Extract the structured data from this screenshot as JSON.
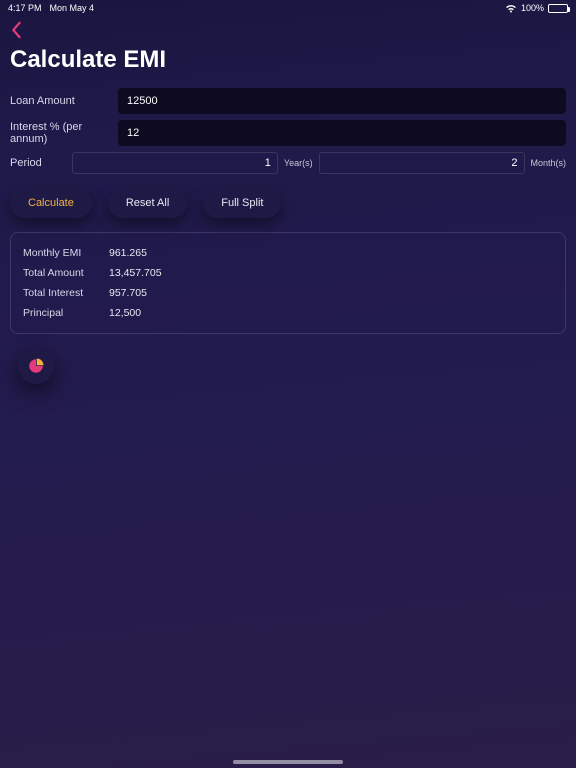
{
  "status": {
    "time": "4:17 PM",
    "date": "Mon May 4",
    "battery_pct": "100%"
  },
  "header": {
    "title": "Calculate EMI"
  },
  "form": {
    "loan_amount_label": "Loan Amount",
    "loan_amount_value": "12500",
    "interest_label": "Interest % (per annum)",
    "interest_value": "12",
    "period_label": "Period",
    "years_value": "1",
    "years_unit": "Year(s)",
    "months_value": "2",
    "months_unit": "Month(s)"
  },
  "buttons": {
    "calculate": "Calculate",
    "reset": "Reset All",
    "full_split": "Full Split"
  },
  "results": {
    "monthly_emi_label": "Monthly EMI",
    "monthly_emi_value": "961.265",
    "total_amount_label": "Total Amount",
    "total_amount_value": "13,457.705",
    "total_interest_label": "Total Interest",
    "total_interest_value": "957.705",
    "principal_label": "Principal",
    "principal_value": "12,500"
  }
}
